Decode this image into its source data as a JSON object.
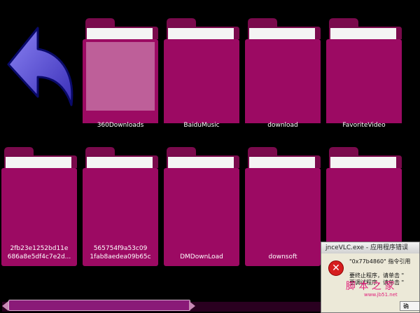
{
  "folders_row1": [
    {
      "label": "360Downloads",
      "selected": true
    },
    {
      "label": "BaiduMusic"
    },
    {
      "label": "download"
    },
    {
      "label": "FavoriteVideo"
    }
  ],
  "folders_row2": [
    {
      "label_line1": "2fb23e1252bd11e",
      "label_line2": "686a8e5df4c7e2d..."
    },
    {
      "label_line1": "565754f9a53c09",
      "label_line2": "1fab8aedea09b65c"
    },
    {
      "label": "DMDownLoad"
    },
    {
      "label": "downsoft"
    }
  ],
  "dialog": {
    "title": "jnceVLC.exe - 应用程序错误",
    "line1": "\"0x77b4860\" 指令引用",
    "line2": "要终止程序，请单击 \"",
    "line3": "要调试程序，请单击 \"",
    "ok_label": "确"
  },
  "watermark": {
    "text": "脚 本 之 家",
    "sub": "www.jb51.net"
  },
  "colors": {
    "folder": "#9c0a63",
    "folder_dark": "#7a0a4c",
    "arrow": "#6a5ee0"
  }
}
